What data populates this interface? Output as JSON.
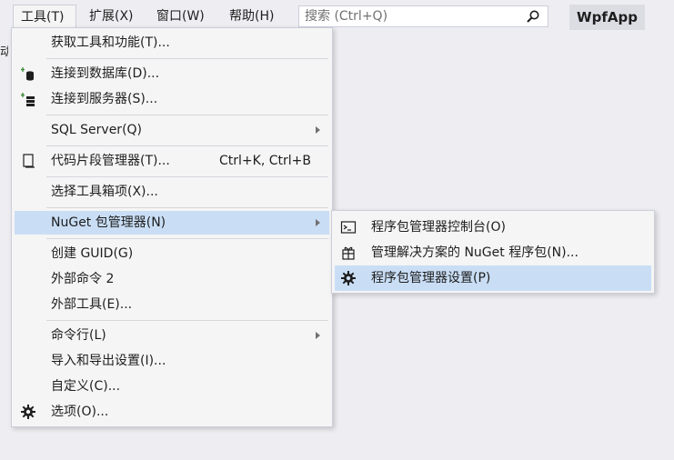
{
  "menubar": {
    "tools": "工具(T)",
    "extensions": "扩展(X)",
    "window": "窗口(W)",
    "help": "帮助(H)"
  },
  "search": {
    "placeholder": "搜索 (Ctrl+Q)"
  },
  "app_title": "WpfApp",
  "left_clip": "动",
  "tools_menu": {
    "get_tools": "获取工具和功能(T)...",
    "connect_db": "连接到数据库(D)...",
    "connect_server": "连接到服务器(S)...",
    "sql_server": "SQL Server(Q)",
    "snippets": "代码片段管理器(T)...",
    "snippets_shortcut": "Ctrl+K, Ctrl+B",
    "choose_toolbox": "选择工具箱项(X)...",
    "nuget": "NuGet 包管理器(N)",
    "create_guid": "创建 GUID(G)",
    "external_cmd": "外部命令 2",
    "external_tools": "外部工具(E)...",
    "command_line": "命令行(L)",
    "import_export": "导入和导出设置(I)...",
    "customize": "自定义(C)...",
    "options": "选项(O)..."
  },
  "nuget_submenu": {
    "console": "程序包管理器控制台(O)",
    "manage_solution": "管理解决方案的 NuGet 程序包(N)...",
    "settings": "程序包管理器设置(P)"
  },
  "colors": {
    "highlight": "#c9def5",
    "menu_bg": "#f5f5f5",
    "background": "#eeeef2"
  }
}
